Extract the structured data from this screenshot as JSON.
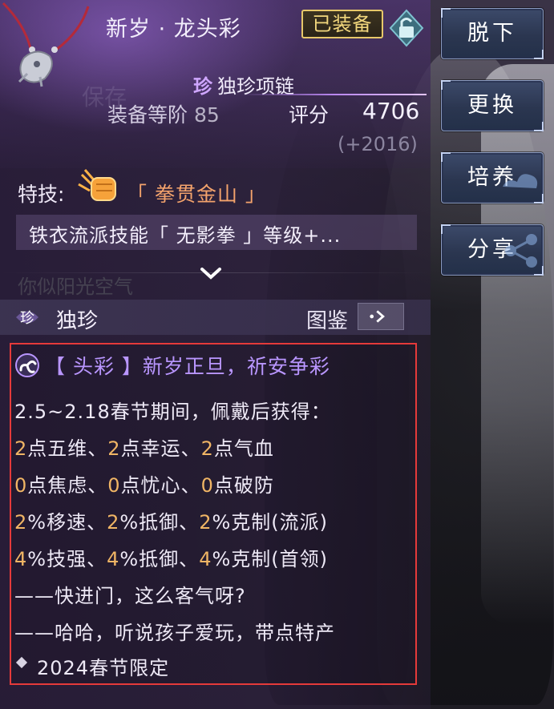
{
  "item": {
    "name": "新岁 · 龙头彩",
    "equipped_badge": "已装备",
    "rarity_mark": "珍",
    "rarity_type": "独珍项链",
    "tier_label": "装备等阶",
    "tier_value": "85",
    "score_label": "评分",
    "score_value": "4706",
    "score_delta": "(+2016)"
  },
  "background_text": {
    "save": "保存",
    "title": "你似阳光空气"
  },
  "skill": {
    "label": "特技:",
    "name": "「 拳贯金山 」",
    "description": "铁衣流派技能「 无影拳 」等级+..."
  },
  "section": {
    "mark": "珍",
    "title": "独珍",
    "atlas_label": "图鉴"
  },
  "bonus": {
    "title": "【 头彩 】新岁正旦，祈安争彩",
    "intro": "2.5~2.18春节期间，佩戴后获得：",
    "stats": [
      [
        {
          "n": "2",
          "t": "点五维、"
        },
        {
          "n": "2",
          "t": "点幸运、"
        },
        {
          "n": "2",
          "t": "点气血"
        }
      ],
      [
        {
          "n": "0",
          "t": "点焦虑、"
        },
        {
          "n": "0",
          "t": "点忧心、"
        },
        {
          "n": "0",
          "t": "点破防"
        }
      ],
      [
        {
          "n": "2",
          "t": "%移速、"
        },
        {
          "n": "2",
          "t": "%抵御、"
        },
        {
          "n": "2",
          "t": "%克制(流派)"
        }
      ],
      [
        {
          "n": "4",
          "t": "%技强、"
        },
        {
          "n": "4",
          "t": "%抵御、"
        },
        {
          "n": "4",
          "t": "%克制(首领)"
        }
      ]
    ],
    "quote_1": "——快进门，这么客气呀?",
    "quote_2": "——哈哈，听说孩子爱玩，带点特产",
    "footer": "2024春节限定"
  },
  "buttons": {
    "unequip": "脱下",
    "replace": "更换",
    "cultivate": "培养",
    "share": "分享"
  },
  "colors": {
    "highlight_number": "#f0b565",
    "skill_name": "#f4a36c",
    "bonus_title": "#b996ff",
    "equipped_gold": "#f2d77d",
    "selection_box": "#e53a3a"
  },
  "icons": [
    "necklace-icon",
    "lock-icon",
    "fist-icon",
    "chevron-down-icon",
    "rarity-icon",
    "arrow-right-icon",
    "swirl-icon",
    "diamond-icon"
  ]
}
